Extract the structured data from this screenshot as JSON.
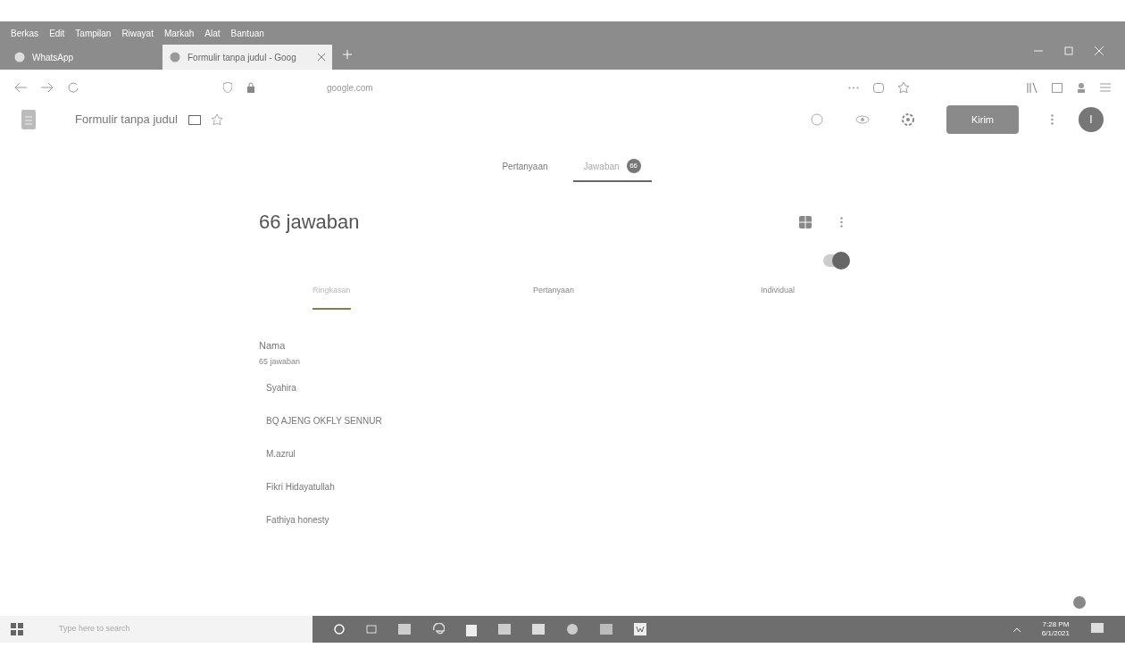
{
  "menu_bar": [
    "Berkas",
    "Edit",
    "Tampilan",
    "Riwayat",
    "Markah",
    "Alat",
    "Bantuan"
  ],
  "browser_tabs": [
    {
      "title": "WhatsApp",
      "selected": false
    },
    {
      "title": "Formulir tanpa judul - Goog",
      "selected": true
    }
  ],
  "address_bar": {
    "url": "google.com"
  },
  "form_header": {
    "title": "Formulir tanpa judul",
    "send_button": "Kirim",
    "avatar": "I"
  },
  "form_tabs": [
    {
      "label": "Pertanyaan",
      "selected": false
    },
    {
      "label": "Jawaban",
      "badge": "66",
      "selected": true
    }
  ],
  "responses": {
    "count": "66 jawaban",
    "accepting": true
  },
  "summary_tabs": [
    {
      "label": "Ringkasan",
      "selected": true
    },
    {
      "label": "Pertanyaan",
      "selected": false
    },
    {
      "label": "Individual",
      "selected": false
    }
  ],
  "question": {
    "title": "Nama",
    "count": "65 jawaban",
    "answers": [
      "Syahira",
      "BQ AJENG OKFLY SENNUR",
      "M.azrul",
      "Fikri Hidayatullah",
      "Fathiya honesty"
    ]
  },
  "taskbar": {
    "search_placeholder": "Type here to search",
    "time": "7:28 PM",
    "date": "6/1/2021"
  }
}
